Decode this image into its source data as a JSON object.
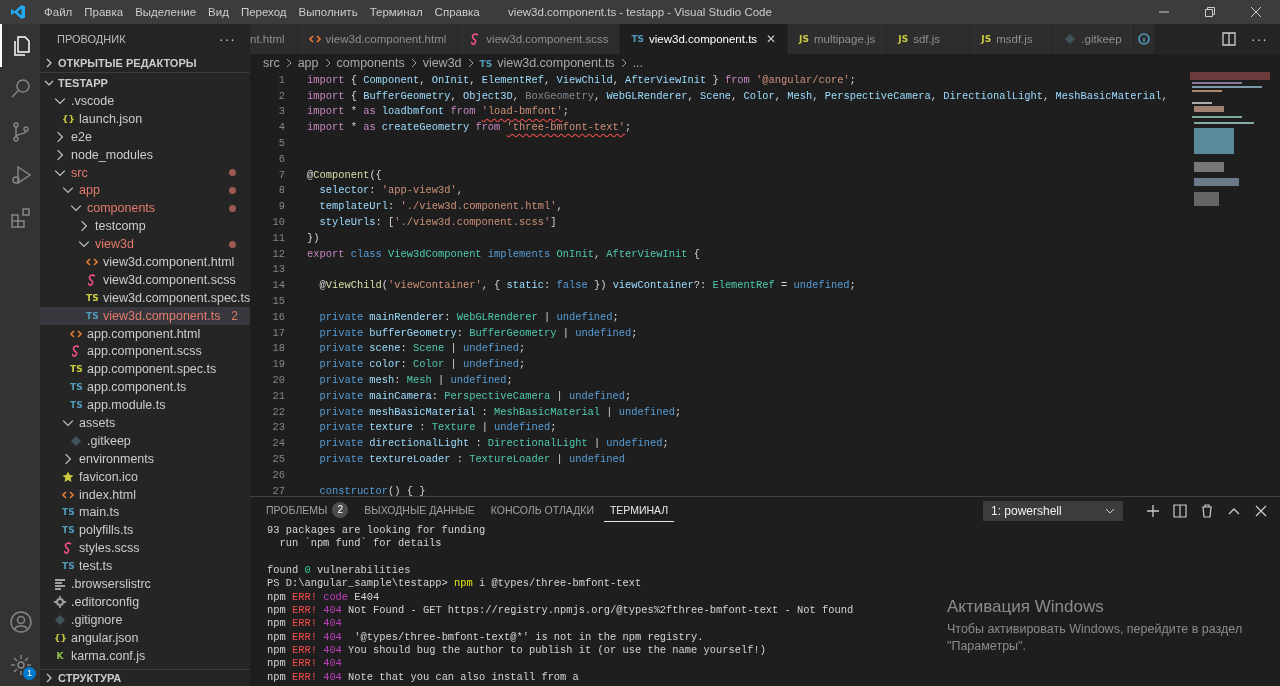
{
  "window": {
    "title": "view3d.component.ts - testapp - Visual Studio Code"
  },
  "menu": [
    "Файл",
    "Правка",
    "Выделение",
    "Вид",
    "Переход",
    "Выполнить",
    "Терминал",
    "Справка"
  ],
  "activity_bar": {
    "top": [
      {
        "kind": "files",
        "selected": true
      },
      {
        "kind": "search",
        "selected": false
      },
      {
        "kind": "git",
        "selected": false
      },
      {
        "kind": "run",
        "selected": false
      },
      {
        "kind": "extensions",
        "selected": false
      }
    ],
    "bottom": [
      {
        "kind": "account"
      },
      {
        "kind": "settings",
        "badge": "1"
      }
    ]
  },
  "sidebar": {
    "title": "ПРОВОДНИК",
    "more": "···",
    "open_editors": {
      "label": "ОТКРЫТЫЕ РЕДАКТОРЫ",
      "expanded": false
    },
    "project": {
      "label": "TESTAPP",
      "expanded": true,
      "tree": [
        {
          "name": ".vscode",
          "kind": "folder",
          "expanded": true,
          "modified": false,
          "selected": false,
          "children": [
            {
              "name": "launch.json",
              "kind": "json",
              "icon_label": "{}",
              "modified": false,
              "selected": false
            }
          ]
        },
        {
          "name": "e2e",
          "kind": "folder",
          "expanded": false,
          "modified": false,
          "selected": false
        },
        {
          "name": "node_modules",
          "kind": "folder",
          "expanded": false,
          "modified": false,
          "selected": false
        },
        {
          "name": "src",
          "kind": "folder",
          "expanded": true,
          "modified": true,
          "selected": false,
          "children": [
            {
              "name": "app",
              "kind": "folder",
              "expanded": true,
              "modified": true,
              "selected": false,
              "children": [
                {
                  "name": "components",
                  "kind": "folder",
                  "expanded": true,
                  "modified": true,
                  "selected": false,
                  "children": [
                    {
                      "name": "testcomp",
                      "kind": "folder",
                      "expanded": false,
                      "modified": false,
                      "selected": false
                    },
                    {
                      "name": "view3d",
                      "kind": "folder",
                      "expanded": true,
                      "modified": true,
                      "selected": false,
                      "children": [
                        {
                          "name": "view3d.component.html",
                          "kind": "html",
                          "modified": false,
                          "selected": false
                        },
                        {
                          "name": "view3d.component.scss",
                          "kind": "scss",
                          "modified": false,
                          "selected": false
                        },
                        {
                          "name": "view3d.component.spec.ts",
                          "kind": "spec",
                          "icon_label": "TS",
                          "modified": false,
                          "selected": false
                        },
                        {
                          "name": "view3d.component.ts",
                          "kind": "ts",
                          "icon_label": "TS",
                          "modified": true,
                          "badge": "2",
                          "selected": true
                        }
                      ]
                    }
                  ]
                },
                {
                  "name": "app.component.html",
                  "kind": "html",
                  "modified": false,
                  "selected": false
                },
                {
                  "name": "app.component.scss",
                  "kind": "scss",
                  "modified": false,
                  "selected": false
                },
                {
                  "name": "app.component.spec.ts",
                  "kind": "spec",
                  "icon_label": "TS",
                  "modified": false,
                  "selected": false
                },
                {
                  "name": "app.component.ts",
                  "kind": "ts",
                  "icon_label": "TS",
                  "modified": false,
                  "selected": false
                },
                {
                  "name": "app.module.ts",
                  "kind": "ts",
                  "icon_label": "TS",
                  "modified": false,
                  "selected": false
                }
              ]
            },
            {
              "name": "assets",
              "kind": "folder",
              "expanded": true,
              "modified": false,
              "selected": false,
              "children": [
                {
                  "name": ".gitkeep",
                  "kind": "gitkeep",
                  "modified": false,
                  "selected": false
                }
              ]
            },
            {
              "name": "environments",
              "kind": "folder",
              "expanded": false,
              "modified": false,
              "selected": false
            },
            {
              "name": "favicon.ico",
              "kind": "star",
              "modified": false,
              "selected": false
            },
            {
              "name": "index.html",
              "kind": "html",
              "modified": false,
              "selected": false
            },
            {
              "name": "main.ts",
              "kind": "ts",
              "icon_label": "TS",
              "modified": false,
              "selected": false
            },
            {
              "name": "polyfills.ts",
              "kind": "ts",
              "icon_label": "TS",
              "modified": false,
              "selected": false
            },
            {
              "name": "styles.scss",
              "kind": "scss",
              "modified": false,
              "selected": false
            },
            {
              "name": "test.ts",
              "kind": "ts",
              "icon_label": "TS",
              "modified": false,
              "selected": false
            }
          ]
        },
        {
          "name": ".browserslistrc",
          "kind": "lines",
          "modified": false,
          "selected": false
        },
        {
          "name": ".editorconfig",
          "kind": "gear",
          "modified": false,
          "selected": false
        },
        {
          "name": ".gitignore",
          "kind": "gitkeep",
          "modified": false,
          "selected": false
        },
        {
          "name": "angular.json",
          "kind": "json",
          "icon_label": "{}",
          "modified": false,
          "selected": false
        },
        {
          "name": "karma.conf.js",
          "kind": "karma",
          "icon_label": "K",
          "modified": false,
          "selected": false
        }
      ]
    },
    "outline": {
      "label": "СТРУКТУРА",
      "expanded": false
    }
  },
  "tabs": [
    {
      "label": "nt.html",
      "kind": "cut",
      "selected": false
    },
    {
      "label": "view3d.component.html",
      "kind": "html",
      "selected": false
    },
    {
      "label": "view3d.component.scss",
      "kind": "scss",
      "selected": false
    },
    {
      "label": "view3d.component.ts",
      "kind": "ts",
      "icon_label": "TS",
      "selected": true,
      "close": "✕"
    },
    {
      "label": "multipage.js",
      "kind": "js",
      "icon_label": "JS",
      "selected": false
    },
    {
      "label": "sdf.js",
      "kind": "js",
      "icon_label": "JS",
      "selected": false
    },
    {
      "label": "msdf.js",
      "kind": "js",
      "icon_label": "JS",
      "selected": false
    },
    {
      "label": ".gitkeep",
      "kind": "gitkeep",
      "selected": false
    },
    {
      "kind": "info",
      "selected": false
    }
  ],
  "editor_actions": {
    "more": "···"
  },
  "breadcrumb": [
    {
      "label": "src"
    },
    {
      "label": "app"
    },
    {
      "label": "components"
    },
    {
      "label": "view3d"
    },
    {
      "label": "view3d.component.ts",
      "icon_label": "TS"
    },
    {
      "label": "..."
    }
  ],
  "code": [
    {
      "n": "1",
      "tokens": [
        {
          "text": "import",
          "kind": "ctl"
        },
        {
          "text": " { ",
          "kind": "p"
        },
        {
          "text": "Component",
          "kind": "var"
        },
        {
          "text": ", ",
          "kind": "p"
        },
        {
          "text": "OnInit",
          "kind": "var"
        },
        {
          "text": ", ",
          "kind": "p"
        },
        {
          "text": "ElementRef",
          "kind": "var"
        },
        {
          "text": ", ",
          "kind": "p"
        },
        {
          "text": "ViewChild",
          "kind": "var"
        },
        {
          "text": ", ",
          "kind": "p"
        },
        {
          "text": "AfterViewInit",
          "kind": "var"
        },
        {
          "text": " } ",
          "kind": "p"
        },
        {
          "text": "from ",
          "kind": "ctl"
        },
        {
          "text": "'@angular/core'",
          "kind": "str"
        },
        {
          "text": ";",
          "kind": "p"
        }
      ]
    },
    {
      "n": "2",
      "tokens": [
        {
          "text": "import",
          "kind": "ctl"
        },
        {
          "text": " { ",
          "kind": "p"
        },
        {
          "text": "BufferGeometry",
          "kind": "var"
        },
        {
          "text": ", ",
          "kind": "p"
        },
        {
          "text": "Object3D",
          "kind": "var"
        },
        {
          "text": ", ",
          "kind": "p"
        },
        {
          "text": "BoxGeometry",
          "kind": "dim"
        },
        {
          "text": ", ",
          "kind": "p"
        },
        {
          "text": "WebGLRenderer",
          "kind": "var"
        },
        {
          "text": ", ",
          "kind": "p"
        },
        {
          "text": "Scene",
          "kind": "var"
        },
        {
          "text": ", ",
          "kind": "p"
        },
        {
          "text": "Color",
          "kind": "var"
        },
        {
          "text": ", ",
          "kind": "p"
        },
        {
          "text": "Mesh",
          "kind": "var"
        },
        {
          "text": ", ",
          "kind": "p"
        },
        {
          "text": "PerspectiveCamera",
          "kind": "var"
        },
        {
          "text": ", ",
          "kind": "p"
        },
        {
          "text": "DirectionalLight",
          "kind": "var"
        },
        {
          "text": ", ",
          "kind": "p"
        },
        {
          "text": "MeshBasicMaterial",
          "kind": "var"
        },
        {
          "text": ",",
          "kind": "p"
        }
      ]
    },
    {
      "n": "3",
      "tokens": [
        {
          "text": "import",
          "kind": "ctl"
        },
        {
          "text": " * ",
          "kind": "p"
        },
        {
          "text": "as ",
          "kind": "ctl"
        },
        {
          "text": "loadbmfont ",
          "kind": "var"
        },
        {
          "text": "from ",
          "kind": "ctl"
        },
        {
          "text": "'load-bmfont'",
          "kind": "str",
          "err": true
        },
        {
          "text": ";",
          "kind": "p"
        }
      ]
    },
    {
      "n": "4",
      "tokens": [
        {
          "text": "import",
          "kind": "ctl"
        },
        {
          "text": " * ",
          "kind": "p"
        },
        {
          "text": "as ",
          "kind": "ctl"
        },
        {
          "text": "createGeometry ",
          "kind": "var"
        },
        {
          "text": "from ",
          "kind": "ctl"
        },
        {
          "text": "'three-bmfont-text'",
          "kind": "str",
          "err": true
        },
        {
          "text": ";",
          "kind": "p"
        }
      ]
    },
    {
      "n": "5"
    },
    {
      "n": "6"
    },
    {
      "n": "7",
      "tokens": [
        {
          "text": "@",
          "kind": "p"
        },
        {
          "text": "Component",
          "kind": "fn"
        },
        {
          "text": "({",
          "kind": "p"
        }
      ]
    },
    {
      "n": "8",
      "tokens": [
        {
          "text": "  selector",
          "kind": "var"
        },
        {
          "text": ": ",
          "kind": "p"
        },
        {
          "text": "'app-view3d'",
          "kind": "str"
        },
        {
          "text": ",",
          "kind": "p"
        }
      ]
    },
    {
      "n": "9",
      "tokens": [
        {
          "text": "  templateUrl",
          "kind": "var"
        },
        {
          "text": ": ",
          "kind": "p"
        },
        {
          "text": "'./view3d.component.html'",
          "kind": "str"
        },
        {
          "text": ",",
          "kind": "p"
        }
      ]
    },
    {
      "n": "10",
      "tokens": [
        {
          "text": "  styleUrls",
          "kind": "var"
        },
        {
          "text": ": [",
          "kind": "p"
        },
        {
          "text": "'./view3d.component.scss'",
          "kind": "str"
        },
        {
          "text": "]",
          "kind": "p"
        }
      ]
    },
    {
      "n": "11",
      "tokens": [
        {
          "text": "})",
          "kind": "p"
        }
      ]
    },
    {
      "n": "12",
      "tokens": [
        {
          "text": "export ",
          "kind": "ctl"
        },
        {
          "text": "class ",
          "kind": "kw"
        },
        {
          "text": "View3dComponent ",
          "kind": "type"
        },
        {
          "text": "implements ",
          "kind": "kw"
        },
        {
          "text": "OnInit",
          "kind": "type"
        },
        {
          "text": ", ",
          "kind": "p"
        },
        {
          "text": "AfterViewInit",
          "kind": "type"
        },
        {
          "text": " {",
          "kind": "p"
        }
      ]
    },
    {
      "n": "13"
    },
    {
      "n": "14",
      "tokens": [
        {
          "text": "  @",
          "kind": "p"
        },
        {
          "text": "ViewChild",
          "kind": "fn"
        },
        {
          "text": "(",
          "kind": "p"
        },
        {
          "text": "'viewContainer'",
          "kind": "str"
        },
        {
          "text": ", { ",
          "kind": "p"
        },
        {
          "text": "static",
          "kind": "var"
        },
        {
          "text": ": ",
          "kind": "p"
        },
        {
          "text": "false",
          "kind": "kw"
        },
        {
          "text": " }) ",
          "kind": "p"
        },
        {
          "text": "viewContainer",
          "kind": "var"
        },
        {
          "text": "?: ",
          "kind": "p"
        },
        {
          "text": "ElementRef",
          "kind": "type"
        },
        {
          "text": " = ",
          "kind": "p"
        },
        {
          "text": "undefined",
          "kind": "kw"
        },
        {
          "text": ";",
          "kind": "p"
        }
      ]
    },
    {
      "n": "15"
    },
    {
      "n": "16",
      "tokens": [
        {
          "text": "  private ",
          "kind": "kw"
        },
        {
          "text": "mainRenderer",
          "kind": "var"
        },
        {
          "text": ": ",
          "kind": "p"
        },
        {
          "text": "WebGLRenderer",
          "kind": "type"
        },
        {
          "text": " | ",
          "kind": "p"
        },
        {
          "text": "undefined",
          "kind": "kw"
        },
        {
          "text": ";",
          "kind": "p"
        }
      ]
    },
    {
      "n": "17",
      "tokens": [
        {
          "text": "  private ",
          "kind": "kw"
        },
        {
          "text": "bufferGeometry",
          "kind": "var"
        },
        {
          "text": ": ",
          "kind": "p"
        },
        {
          "text": "BufferGeometry",
          "kind": "type"
        },
        {
          "text": " | ",
          "kind": "p"
        },
        {
          "text": "undefined",
          "kind": "kw"
        },
        {
          "text": ";",
          "kind": "p"
        }
      ]
    },
    {
      "n": "18",
      "tokens": [
        {
          "text": "  private ",
          "kind": "kw"
        },
        {
          "text": "scene",
          "kind": "var"
        },
        {
          "text": ": ",
          "kind": "p"
        },
        {
          "text": "Scene",
          "kind": "type"
        },
        {
          "text": " | ",
          "kind": "p"
        },
        {
          "text": "undefined",
          "kind": "kw"
        },
        {
          "text": ";",
          "kind": "p"
        }
      ]
    },
    {
      "n": "19",
      "tokens": [
        {
          "text": "  private ",
          "kind": "kw"
        },
        {
          "text": "color",
          "kind": "var"
        },
        {
          "text": ": ",
          "kind": "p"
        },
        {
          "text": "Color",
          "kind": "type"
        },
        {
          "text": " | ",
          "kind": "p"
        },
        {
          "text": "undefined",
          "kind": "kw"
        },
        {
          "text": ";",
          "kind": "p"
        }
      ]
    },
    {
      "n": "20",
      "tokens": [
        {
          "text": "  private ",
          "kind": "kw"
        },
        {
          "text": "mesh",
          "kind": "var"
        },
        {
          "text": ": ",
          "kind": "p"
        },
        {
          "text": "Mesh",
          "kind": "type"
        },
        {
          "text": " | ",
          "kind": "p"
        },
        {
          "text": "undefined",
          "kind": "kw"
        },
        {
          "text": ";",
          "kind": "p"
        }
      ]
    },
    {
      "n": "21",
      "tokens": [
        {
          "text": "  private ",
          "kind": "kw"
        },
        {
          "text": "mainCamera",
          "kind": "var"
        },
        {
          "text": ": ",
          "kind": "p"
        },
        {
          "text": "PerspectiveCamera",
          "kind": "type"
        },
        {
          "text": " | ",
          "kind": "p"
        },
        {
          "text": "undefined",
          "kind": "kw"
        },
        {
          "text": ";",
          "kind": "p"
        }
      ]
    },
    {
      "n": "22",
      "tokens": [
        {
          "text": "  private ",
          "kind": "kw"
        },
        {
          "text": "meshBasicMaterial",
          "kind": "var"
        },
        {
          "text": " : ",
          "kind": "p"
        },
        {
          "text": "MeshBasicMaterial",
          "kind": "type"
        },
        {
          "text": " | ",
          "kind": "p"
        },
        {
          "text": "undefined",
          "kind": "kw"
        },
        {
          "text": ";",
          "kind": "p"
        }
      ]
    },
    {
      "n": "23",
      "tokens": [
        {
          "text": "  private ",
          "kind": "kw"
        },
        {
          "text": "texture",
          "kind": "var"
        },
        {
          "text": " : ",
          "kind": "p"
        },
        {
          "text": "Texture",
          "kind": "type"
        },
        {
          "text": " | ",
          "kind": "p"
        },
        {
          "text": "undefined",
          "kind": "kw"
        },
        {
          "text": ";",
          "kind": "p"
        }
      ]
    },
    {
      "n": "24",
      "tokens": [
        {
          "text": "  private ",
          "kind": "kw"
        },
        {
          "text": "directionalLight",
          "kind": "var"
        },
        {
          "text": " : ",
          "kind": "p"
        },
        {
          "text": "DirectionalLight",
          "kind": "type"
        },
        {
          "text": " | ",
          "kind": "p"
        },
        {
          "text": "undefined",
          "kind": "kw"
        },
        {
          "text": ";",
          "kind": "p"
        }
      ]
    },
    {
      "n": "25",
      "tokens": [
        {
          "text": "  private ",
          "kind": "kw"
        },
        {
          "text": "textureLoader",
          "kind": "var"
        },
        {
          "text": " : ",
          "kind": "p"
        },
        {
          "text": "TextureLoader",
          "kind": "type"
        },
        {
          "text": " | ",
          "kind": "p"
        },
        {
          "text": "undefined",
          "kind": "kw"
        }
      ]
    },
    {
      "n": "26"
    },
    {
      "n": "27",
      "tokens": [
        {
          "text": "  constructor",
          "kind": "kw"
        },
        {
          "text": "() { }",
          "kind": "p"
        }
      ]
    }
  ],
  "panel": {
    "tabs": [
      {
        "label": "ПРОБЛЕМЫ",
        "badge": "2",
        "selected": false
      },
      {
        "label": "ВЫХОДНЫЕ ДАННЫЕ",
        "selected": false
      },
      {
        "label": "КОНСОЛЬ ОТЛАДКИ",
        "selected": false
      },
      {
        "label": "ТЕРМИНАЛ",
        "selected": true
      }
    ],
    "terminal_select": "1: powershell",
    "terminal": [
      {
        "lines": [
          {
            "tokens": [
              {
                "text": "93 packages are looking for funding",
                "kind": "p"
              }
            ]
          },
          {
            "tokens": [
              {
                "text": "  run `npm fund` for details",
                "kind": "p"
              }
            ]
          }
        ]
      },
      {
        "lines": [
          {
            "tokens": [
              {
                "text": "found ",
                "kind": "p"
              },
              {
                "text": "0",
                "kind": "num"
              },
              {
                "text": " vulnerabilities",
                "kind": "p"
              }
            ]
          },
          {
            "tokens": [
              {
                "text": "PS D:\\angular_sample\\testapp> ",
                "kind": "p"
              },
              {
                "text": "npm",
                "kind": "cmd"
              },
              {
                "text": " i @types/three-bmfont-text",
                "kind": "p"
              }
            ]
          },
          {
            "tokens": [
              {
                "text": "npm ",
                "kind": "p"
              },
              {
                "text": "ERR!",
                "kind": "err"
              },
              {
                "text": " code",
                "kind": "mag"
              },
              {
                "text": " E404",
                "kind": "p"
              }
            ]
          },
          {
            "tokens": [
              {
                "text": "npm ",
                "kind": "p"
              },
              {
                "text": "ERR!",
                "kind": "err"
              },
              {
                "text": " 404",
                "kind": "mag"
              },
              {
                "text": " Not Found - GET https://registry.npmjs.org/@types%2fthree-bmfont-text - Not found",
                "kind": "p"
              }
            ]
          },
          {
            "tokens": [
              {
                "text": "npm ",
                "kind": "p"
              },
              {
                "text": "ERR!",
                "kind": "err"
              },
              {
                "text": " 404",
                "kind": "mag"
              }
            ]
          },
          {
            "tokens": [
              {
                "text": "npm ",
                "kind": "p"
              },
              {
                "text": "ERR!",
                "kind": "err"
              },
              {
                "text": " 404",
                "kind": "mag"
              },
              {
                "text": "  '@types/three-bmfont-text@*' is not in the npm registry.",
                "kind": "p"
              }
            ]
          },
          {
            "tokens": [
              {
                "text": "npm ",
                "kind": "p"
              },
              {
                "text": "ERR!",
                "kind": "err"
              },
              {
                "text": " 404",
                "kind": "mag"
              },
              {
                "text": " You should bug the author to publish it (or use the name yourself!)",
                "kind": "p"
              }
            ]
          },
          {
            "tokens": [
              {
                "text": "npm ",
                "kind": "p"
              },
              {
                "text": "ERR!",
                "kind": "err"
              },
              {
                "text": " 404",
                "kind": "mag"
              }
            ]
          },
          {
            "tokens": [
              {
                "text": "npm ",
                "kind": "p"
              },
              {
                "text": "ERR!",
                "kind": "err"
              },
              {
                "text": " 404",
                "kind": "mag"
              },
              {
                "text": " Note that you can also install from a",
                "kind": "p"
              }
            ]
          }
        ]
      }
    ]
  },
  "activation_notice": {
    "title": "Активация Windows",
    "lines": [
      "Чтобы активировать Windows, перейдите в раздел",
      "\"Параметры\"."
    ]
  }
}
